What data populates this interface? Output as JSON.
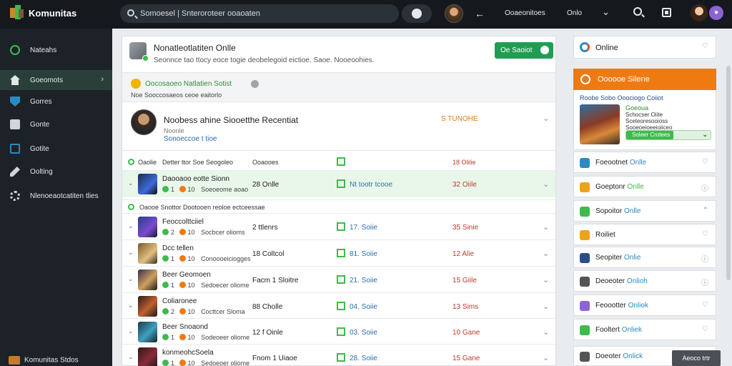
{
  "app": {
    "title": "Komunitas"
  },
  "search": {
    "value": "Somoesel | Snteroroteer ooaoaten"
  },
  "topbar": {
    "link1": "Ooaeonitoes",
    "link2": "Onlo"
  },
  "sidebar": {
    "items": [
      {
        "label": "Nateahs",
        "icon": "home-icon",
        "active": false
      },
      {
        "label": "Goeomots",
        "icon": "home-icon",
        "active": true
      },
      {
        "label": "Gorres",
        "icon": "shield-icon",
        "active": false
      },
      {
        "label": "Gonte",
        "icon": "book-icon",
        "active": false
      },
      {
        "label": "Gotite",
        "icon": "monitor-icon",
        "active": false
      },
      {
        "label": "Oolting",
        "icon": "pencil-icon",
        "active": false
      },
      {
        "label": "Nlenoeaotcatiten tlies",
        "icon": "gear-icon",
        "active": false
      }
    ],
    "footer": "Komunitas Stdos"
  },
  "main": {
    "header": {
      "title": "Nonatleotlatiten Onlle",
      "subtitle": "Seonnce tao ttocy eoce togie deobelegoid eictioe. Saoe. Nooeoohies.",
      "join_label": "Oe Saoiot"
    },
    "strip": {
      "title": "Oocosaoeo Natlatien Sotist",
      "sub": "Noe Sooccosaeos ceoe eaitorlo"
    },
    "featured": {
      "name": "Noobess ahine Siooetthe Recentiat",
      "sub": "Noonle",
      "link": "Sonoeccoe t tioe",
      "status": "S TUNOHE"
    },
    "columns": {
      "a": "Oaolie",
      "b": "Detter ttor Soe Seogoleo",
      "c": "Ooaooes",
      "d": "18 Olilie"
    },
    "rows": [
      {
        "name": "Daooaoo eotte Sionn",
        "meta1": "1",
        "meta2": "10",
        "meta3": "Soeoeome aoao",
        "count": "28 Onlle",
        "pct": "Nt tootr tcooe",
        "online": "32 Oiile",
        "highlight": true
      },
      {
        "name": "Feoccolttciiel",
        "meta1": "2",
        "meta2": "10",
        "meta3": "Socbcer olioms",
        "count": "2 ttlenrs",
        "pct": "17. Soiie",
        "online": "35 Sinie",
        "highlight": false
      },
      {
        "name": "Dcc tellen",
        "meta1": "1",
        "meta2": "10",
        "meta3": "Conoooeiciogges",
        "count": "18 Coltcol",
        "pct": "81. Soiie",
        "online": "12 Alie",
        "highlight": false
      },
      {
        "name": "Beer Geomoen",
        "meta1": "1",
        "meta2": "10",
        "meta3": "Sedoecer oliome",
        "count": "Facm 1 Sloitre",
        "pct": "21. Soiie",
        "online": "15 Giile",
        "highlight": false
      },
      {
        "name": "Coliaronee",
        "meta1": "2",
        "meta2": "10",
        "meta3": "Cocttcer Sloma",
        "count": "88 Cholle",
        "pct": "04. Soiie",
        "online": "13 Sims",
        "highlight": false
      },
      {
        "name": "Beer Snoaond",
        "meta1": "1",
        "meta2": "10",
        "meta3": "Sodeoeer oliome",
        "count": "12 f Oinle",
        "pct": "03. Soiie",
        "online": "10 Gane",
        "highlight": false
      },
      {
        "name": "konmeohcSoela",
        "meta1": "1",
        "meta2": "10",
        "meta3": "Sedoeoer oliome",
        "count": "Fnom 1 Uiaoe",
        "pct": "28. Soiie",
        "online": "15 Gane",
        "highlight": false
      }
    ],
    "subrow": "Oaooe Snottor Dootooen reoloe ectceessae"
  },
  "right": {
    "online_label": "Online",
    "orange_label": "Oooooe Silene",
    "promo": {
      "title": "Roobe Sobo Ooociogo Coiiot",
      "green": "Goeoua",
      "lines": [
        "Schocser Oiite",
        "Sceteoresooioss",
        "Sooeoeioeeioiiceo"
      ],
      "bar": "Soleer Crotees"
    },
    "cards": [
      {
        "label": "Foeootnet",
        "accent": "Onlle",
        "accent_color": "#2b8ac4",
        "icon_color": "#2b8ac4",
        "end": "heart"
      },
      {
        "label": "Goeptonr",
        "accent": "Onlle",
        "accent_color": "#3dbb4c",
        "icon_color": "#f0a020",
        "end": "info"
      },
      {
        "label": "Sopoitor",
        "accent": "Onlle",
        "accent_color": "#2b8ac4",
        "icon_color": "#3dbb4c",
        "end": "caret"
      },
      {
        "label": "Roiliet",
        "accent": "",
        "accent_color": "#2b8ac4",
        "icon_color": "#f0a020",
        "end": "heart"
      },
      {
        "label": "Seopiter",
        "accent": "Onlie",
        "accent_color": "#2b8ac4",
        "icon_color": "#2b4d8c",
        "end": "info"
      },
      {
        "label": "Deoeoter",
        "accent": "Onlioh",
        "accent_color": "#2b8ac4",
        "icon_color": "#555",
        "end": "info"
      },
      {
        "label": "Feoootter",
        "accent": "Onliok",
        "accent_color": "#2b8ac4",
        "icon_color": "#8e63d6",
        "end": "heart"
      },
      {
        "label": "Fooltert",
        "accent": "Onliek",
        "accent_color": "#2b8ac4",
        "icon_color": "#3dbb4c",
        "end": "heart"
      },
      {
        "label": "Doeoter",
        "accent": "Onlick",
        "accent_color": "#2b8ac4",
        "icon_color": "#555",
        "end": ""
      }
    ],
    "tooltip": "Aeoco trtr"
  }
}
